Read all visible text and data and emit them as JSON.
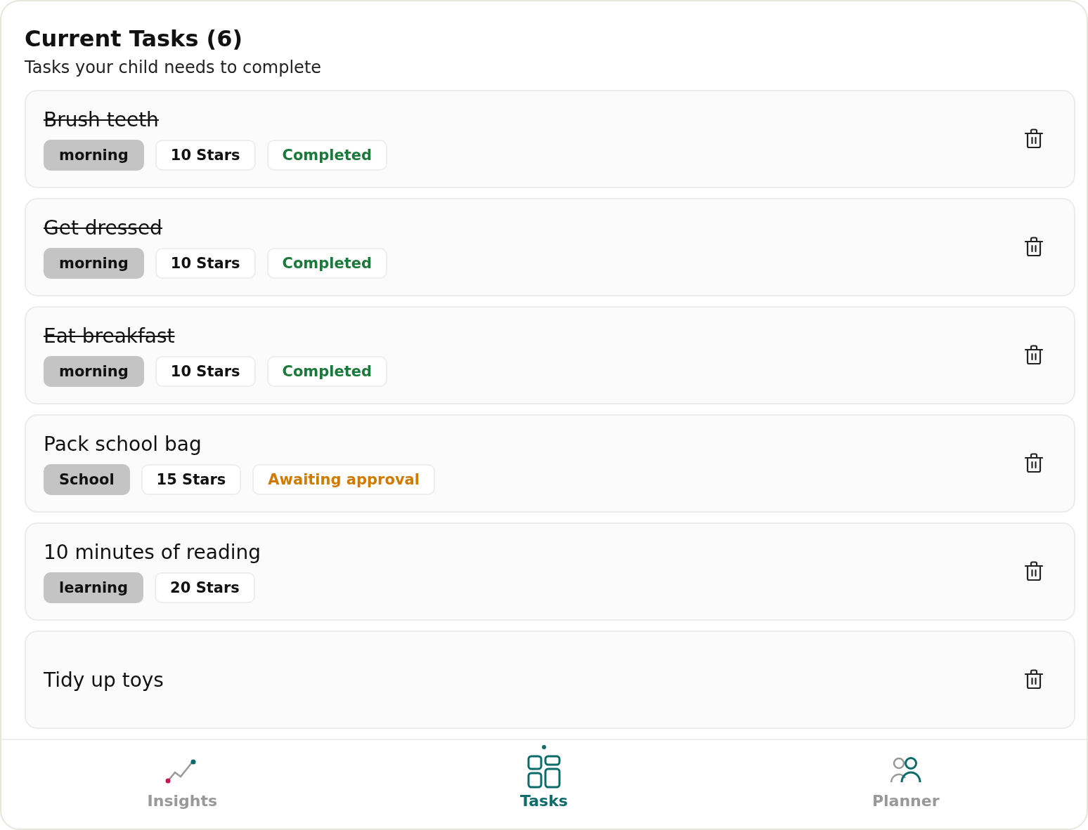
{
  "header": {
    "title": "Current Tasks (6)",
    "subtitle": "Tasks your child needs to complete"
  },
  "tasks": [
    {
      "title": "Brush teeth",
      "completed": true,
      "category": "morning",
      "stars_label": "10 Stars",
      "status": {
        "label": "Completed",
        "kind": "completed"
      }
    },
    {
      "title": "Get dressed",
      "completed": true,
      "category": "morning",
      "stars_label": "10 Stars",
      "status": {
        "label": "Completed",
        "kind": "completed"
      }
    },
    {
      "title": "Eat breakfast",
      "completed": true,
      "category": "morning",
      "stars_label": "10 Stars",
      "status": {
        "label": "Completed",
        "kind": "completed"
      }
    },
    {
      "title": "Pack school bag",
      "completed": false,
      "category": "School",
      "stars_label": "15 Stars",
      "status": {
        "label": "Awaiting approval",
        "kind": "pending"
      }
    },
    {
      "title": "10 minutes of reading",
      "completed": false,
      "category": "learning",
      "stars_label": "20 Stars"
    },
    {
      "title": "Tidy up toys",
      "completed": false
    }
  ],
  "nav": [
    {
      "label": "Insights",
      "kind": "insights",
      "selected": false
    },
    {
      "label": "Tasks",
      "kind": "tasks",
      "selected": true
    },
    {
      "label": "Planner",
      "kind": "planner",
      "selected": false
    }
  ]
}
